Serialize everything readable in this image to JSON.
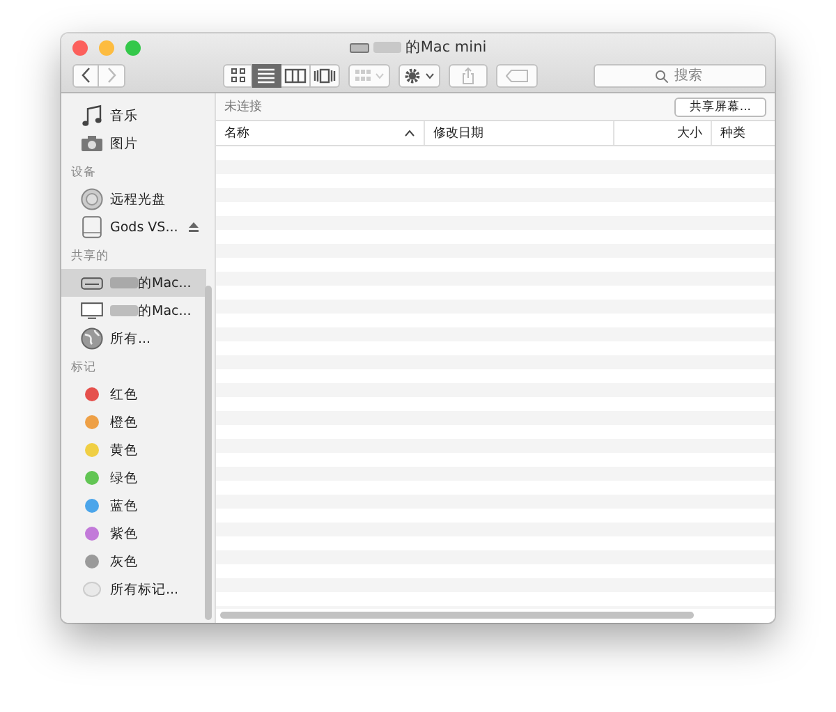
{
  "window": {
    "title": "的Mac mini",
    "title_redacted": true
  },
  "toolbar": {
    "view_modes": [
      {
        "kind": "icons",
        "selected": false
      },
      {
        "kind": "list",
        "selected": true
      },
      {
        "kind": "columns",
        "selected": false
      },
      {
        "kind": "coverflow",
        "selected": false
      }
    ],
    "search": {
      "placeholder": "搜索"
    }
  },
  "sidebar": {
    "sections": [
      {
        "items": [
          {
            "label": "音乐",
            "kind": "music",
            "selected": false
          },
          {
            "label": "图片",
            "kind": "camera",
            "selected": false
          }
        ]
      },
      {
        "heading": "设备",
        "items": [
          {
            "label": "远程光盘",
            "kind": "disc",
            "selected": false
          },
          {
            "label": "Gods VS...",
            "kind": "drive",
            "selected": false,
            "eject": true
          }
        ]
      },
      {
        "heading": "共享的",
        "items": [
          {
            "label": "的Mac...",
            "kind": "server",
            "selected": true,
            "redacted": true
          },
          {
            "label": "的Mac...",
            "kind": "display",
            "selected": false,
            "redacted": true
          },
          {
            "label": "所有...",
            "kind": "globe",
            "selected": false
          }
        ]
      },
      {
        "heading": "标记",
        "items": [
          {
            "label": "红色",
            "kind": "tag",
            "color": "#e5504c",
            "selected": false
          },
          {
            "label": "橙色",
            "kind": "tag",
            "color": "#eea046",
            "selected": false
          },
          {
            "label": "黄色",
            "kind": "tag",
            "color": "#f0cf44",
            "selected": false
          },
          {
            "label": "绿色",
            "kind": "tag",
            "color": "#62c554",
            "selected": false
          },
          {
            "label": "蓝色",
            "kind": "tag",
            "color": "#4ba5ea",
            "selected": false
          },
          {
            "label": "紫色",
            "kind": "tag",
            "color": "#c27ad9",
            "selected": false
          },
          {
            "label": "灰色",
            "kind": "tag",
            "color": "#9a9a9a",
            "selected": false
          },
          {
            "label": "所有标记...",
            "kind": "alltags",
            "selected": false
          }
        ]
      }
    ]
  },
  "status": {
    "text": "未连接",
    "button": "共享屏幕..."
  },
  "table": {
    "columns": [
      {
        "label": "名称",
        "sorted": true
      },
      {
        "label": "修改日期",
        "sorted": false
      },
      {
        "label": "大小",
        "sorted": false
      },
      {
        "label": "种类",
        "sorted": false
      }
    ]
  }
}
